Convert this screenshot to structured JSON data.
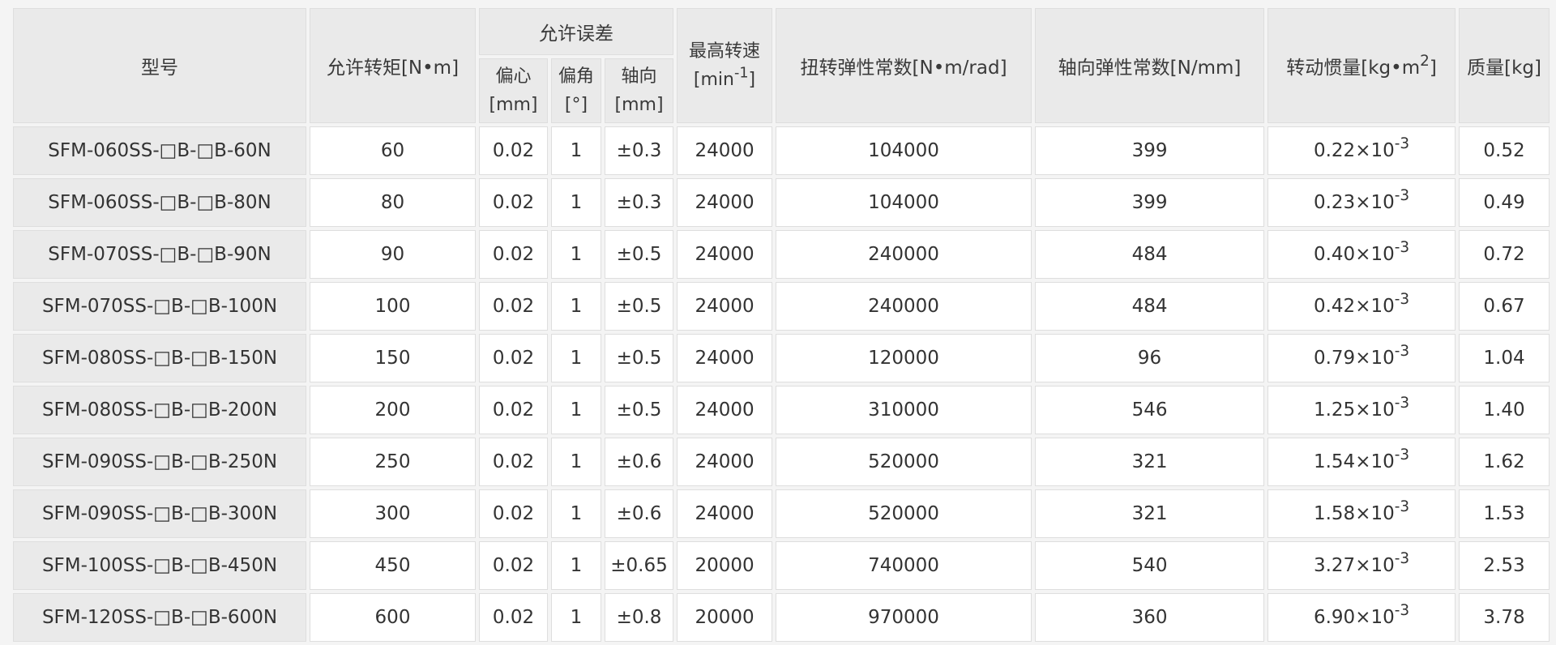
{
  "table": {
    "headers": {
      "model": "型号",
      "torque": "允许转矩[N•m]",
      "tolerance_group": "允许误差",
      "tolerance_sub": [
        {
          "name": "偏心",
          "unit": "[mm]"
        },
        {
          "name": "偏角",
          "unit": "[°]"
        },
        {
          "name": "轴向",
          "unit": "[mm]"
        }
      ],
      "max_speed": {
        "name": "最高转速",
        "unit_base": "[min",
        "unit_exp": "-1",
        "unit_close": "]"
      },
      "torsional_stiffness": "扭转弹性常数[N•m/rad]",
      "axial_stiffness": "轴向弹性常数[N/mm]",
      "inertia": {
        "base": "转动惯量[kg•m",
        "exp": "2",
        "close": "]"
      },
      "mass": "质量[kg]"
    },
    "rows": [
      {
        "model": "SFM-060SS-□B-□B-60N",
        "torque": "60",
        "eccentric": "0.02",
        "angle": "1",
        "axial": "±0.3",
        "speed": "24000",
        "torsional": "104000",
        "axial_k": "399",
        "inertia_mant": "0.22×10",
        "inertia_exp": "-3",
        "mass": "0.52"
      },
      {
        "model": "SFM-060SS-□B-□B-80N",
        "torque": "80",
        "eccentric": "0.02",
        "angle": "1",
        "axial": "±0.3",
        "speed": "24000",
        "torsional": "104000",
        "axial_k": "399",
        "inertia_mant": "0.23×10",
        "inertia_exp": "-3",
        "mass": "0.49"
      },
      {
        "model": "SFM-070SS-□B-□B-90N",
        "torque": "90",
        "eccentric": "0.02",
        "angle": "1",
        "axial": "±0.5",
        "speed": "24000",
        "torsional": "240000",
        "axial_k": "484",
        "inertia_mant": "0.40×10",
        "inertia_exp": "-3",
        "mass": "0.72"
      },
      {
        "model": "SFM-070SS-□B-□B-100N",
        "torque": "100",
        "eccentric": "0.02",
        "angle": "1",
        "axial": "±0.5",
        "speed": "24000",
        "torsional": "240000",
        "axial_k": "484",
        "inertia_mant": "0.42×10",
        "inertia_exp": "-3",
        "mass": "0.67"
      },
      {
        "model": "SFM-080SS-□B-□B-150N",
        "torque": "150",
        "eccentric": "0.02",
        "angle": "1",
        "axial": "±0.5",
        "speed": "24000",
        "torsional": "120000",
        "axial_k": "96",
        "inertia_mant": "0.79×10",
        "inertia_exp": "-3",
        "mass": "1.04"
      },
      {
        "model": "SFM-080SS-□B-□B-200N",
        "torque": "200",
        "eccentric": "0.02",
        "angle": "1",
        "axial": "±0.5",
        "speed": "24000",
        "torsional": "310000",
        "axial_k": "546",
        "inertia_mant": "1.25×10",
        "inertia_exp": "-3",
        "mass": "1.40"
      },
      {
        "model": "SFM-090SS-□B-□B-250N",
        "torque": "250",
        "eccentric": "0.02",
        "angle": "1",
        "axial": "±0.6",
        "speed": "24000",
        "torsional": "520000",
        "axial_k": "321",
        "inertia_mant": "1.54×10",
        "inertia_exp": "-3",
        "mass": "1.62"
      },
      {
        "model": "SFM-090SS-□B-□B-300N",
        "torque": "300",
        "eccentric": "0.02",
        "angle": "1",
        "axial": "±0.6",
        "speed": "24000",
        "torsional": "520000",
        "axial_k": "321",
        "inertia_mant": "1.58×10",
        "inertia_exp": "-3",
        "mass": "1.53"
      },
      {
        "model": "SFM-100SS-□B-□B-450N",
        "torque": "450",
        "eccentric": "0.02",
        "angle": "1",
        "axial": "±0.65",
        "speed": "20000",
        "torsional": "740000",
        "axial_k": "540",
        "inertia_mant": "3.27×10",
        "inertia_exp": "-3",
        "mass": "2.53"
      },
      {
        "model": "SFM-120SS-□B-□B-600N",
        "torque": "600",
        "eccentric": "0.02",
        "angle": "1",
        "axial": "±0.8",
        "speed": "20000",
        "torsional": "970000",
        "axial_k": "360",
        "inertia_mant": "6.90×10",
        "inertia_exp": "-3",
        "mass": "3.78"
      }
    ]
  }
}
